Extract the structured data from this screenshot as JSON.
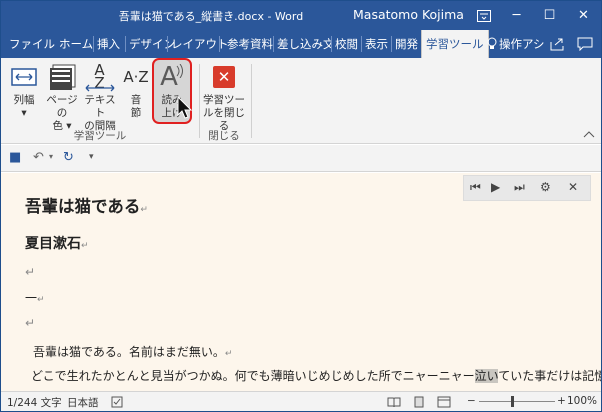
{
  "titlebar": {
    "doc_title": "吾輩は猫である_縦書き.docx - Word",
    "user": "Masatomo Kojima",
    "btn_restore_icon": "□",
    "btn_minimize": "─",
    "btn_maximize": "☐",
    "btn_close": "✕"
  },
  "tabs": [
    {
      "label": "ファイル"
    },
    {
      "label": "ホーム"
    },
    {
      "label": "挿入"
    },
    {
      "label": "デザイン"
    },
    {
      "label": "レイアウト"
    },
    {
      "label": "参考資料"
    },
    {
      "label": "差し込み文書"
    },
    {
      "label": "校閲"
    },
    {
      "label": "表示"
    },
    {
      "label": "開発"
    },
    {
      "label": "学習ツール"
    },
    {
      "label": "操作アシ"
    }
  ],
  "ribbon": {
    "column_width": {
      "line1": "列幅",
      "line2": "▾"
    },
    "page_color": {
      "line1": "ページの",
      "line2": "色 ▾"
    },
    "text_spacing": {
      "line1": "テキスト",
      "line2": "の間隔",
      "icon_text": "A Z"
    },
    "syllables": {
      "line1": "音",
      "line2": "節",
      "icon_text": "A·Z"
    },
    "read_aloud": {
      "line1": "読み",
      "line2": "上げ",
      "icon_text": "A"
    },
    "close_tools": {
      "line1": "学習ツー",
      "line2": "ルを閉じる",
      "icon_text": "✕"
    },
    "group_learning": "学習ツール",
    "group_close": "閉じる"
  },
  "qat": {
    "save_icon": "■",
    "undo_icon": "↶",
    "redo_icon": "↻",
    "customize_icon": "▾"
  },
  "readbar": {
    "prev": "⏮",
    "play": "▶",
    "pause": "⏸",
    "next": "⏭",
    "settings": "⚙",
    "close": "✕"
  },
  "doc": {
    "title": "吾輩は猫である",
    "author": "夏目漱石",
    "para_mark": "↵",
    "dash": "一",
    "line1": "吾輩は猫である。名前はまだ無い。",
    "line2_a": "どこで生れたかとんと見当がつかぬ。何でも薄暗いじめじめした所でニャーニャー",
    "line2_hl": "泣い",
    "line2_b": "ていた事だけは記憶し"
  },
  "status": {
    "words": "1/244 文字",
    "language": "日本語",
    "zoom_minus": "−",
    "zoom_plus": "+",
    "zoom": "100%"
  },
  "colors": {
    "brand": "#2b579a",
    "highlight_ring": "#e02020",
    "close_red": "#d83b2b",
    "doc_bg": "#fdf6ec"
  }
}
